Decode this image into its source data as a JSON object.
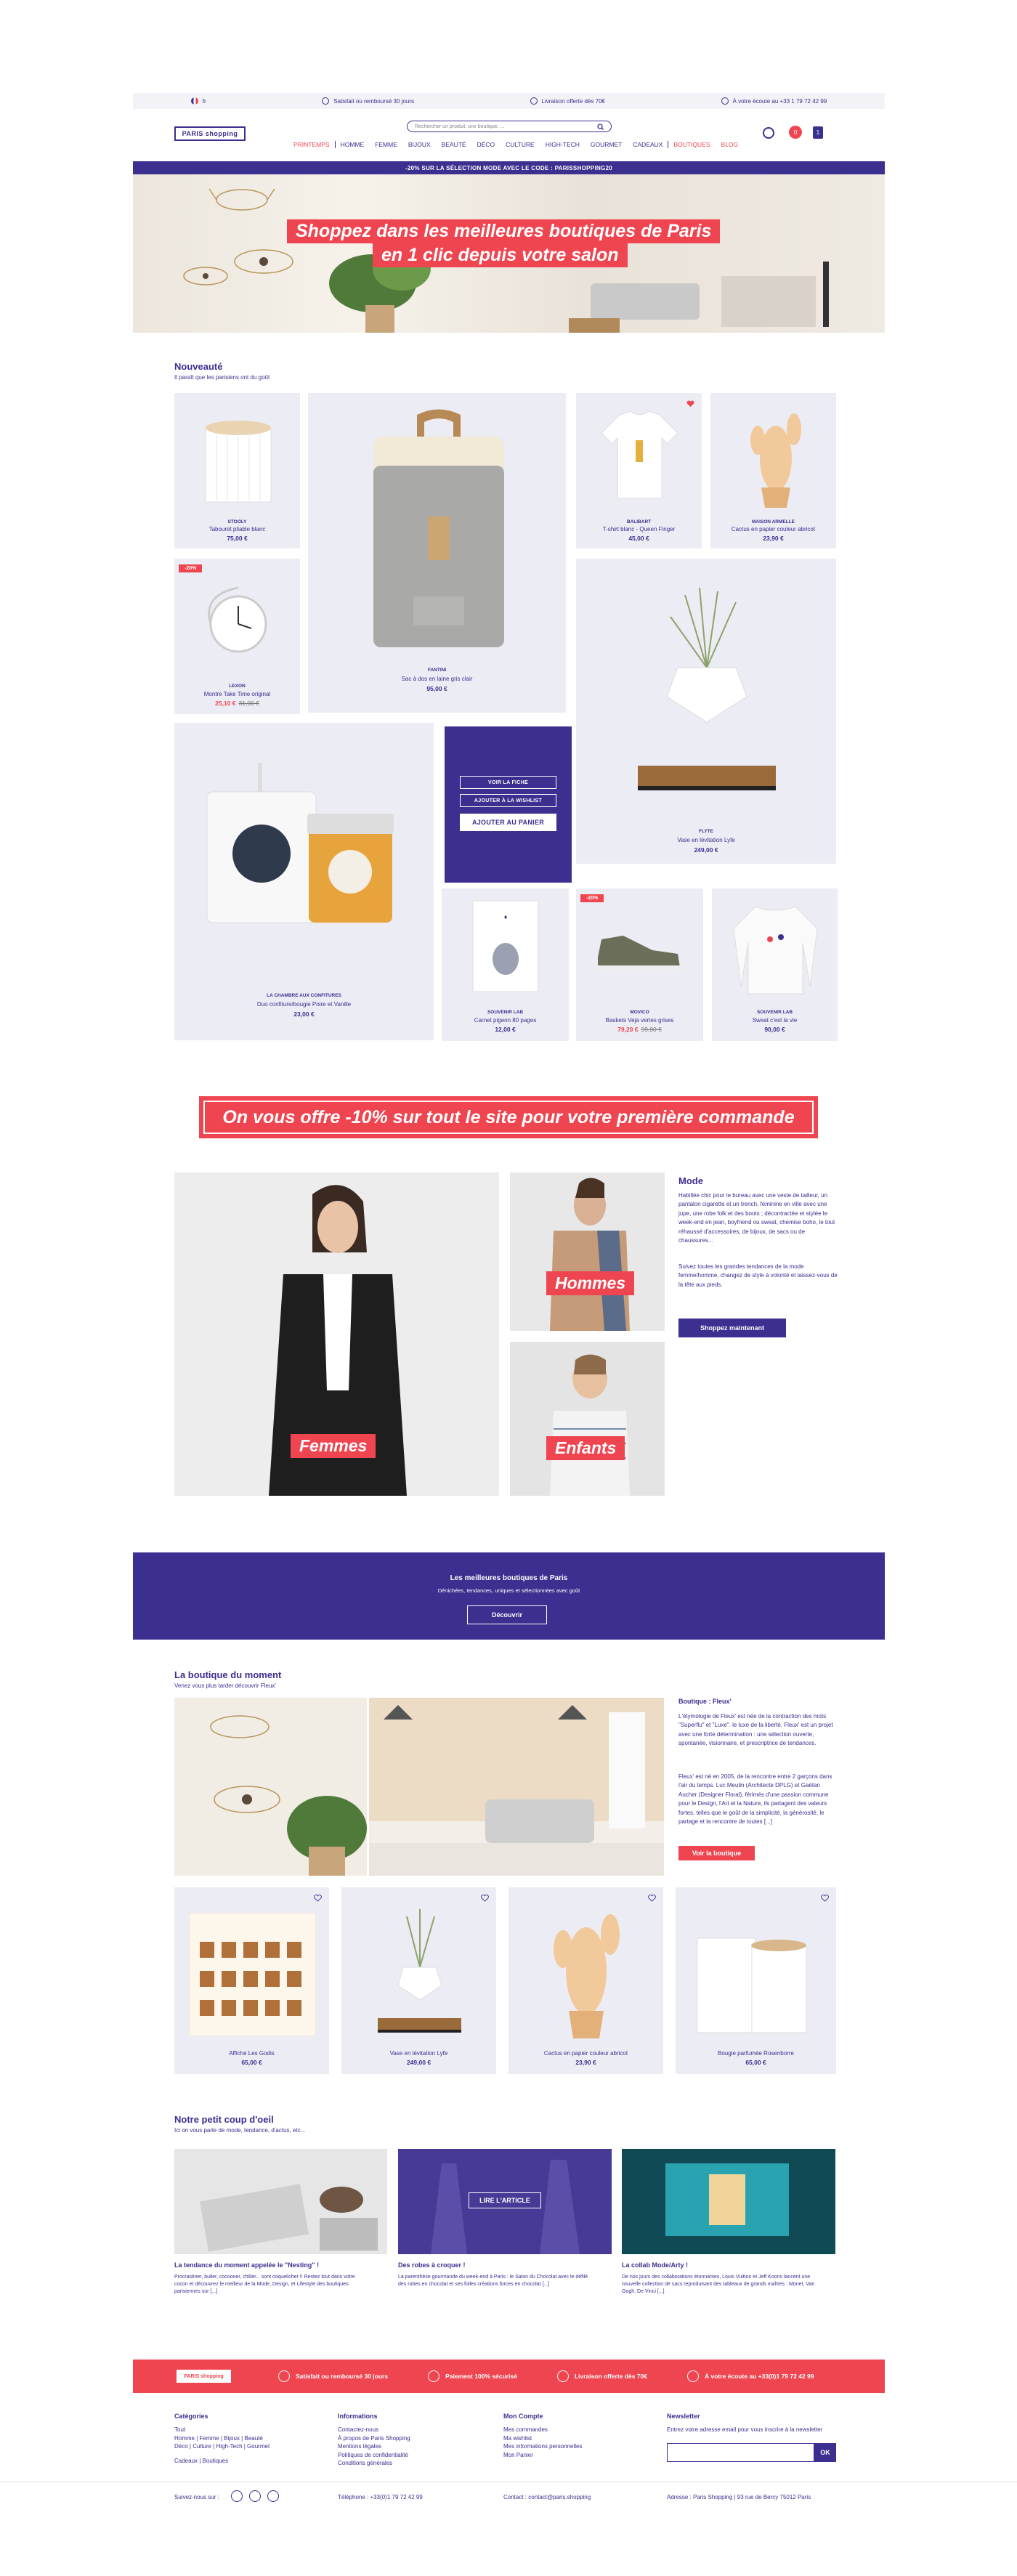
{
  "topbar": {
    "lang": "fr",
    "item1": "Satisfait ou remboursé 30 jours",
    "item2": "Livraison offerte dès 70€",
    "item3": "À votre écoute au +33 1 79 72 42 99"
  },
  "header": {
    "logo": "PARIS shopping",
    "search_placeholder": "Rechercher un produit, une boutique, ...",
    "cart_count": "1",
    "wishlist_count": "0",
    "nav": [
      "PRINTEMPS",
      "HOMME",
      "FEMME",
      "BIJOUX",
      "BEAUTÉ",
      "DÉCO",
      "CULTURE",
      "HIGH-TECH",
      "GOURMET",
      "CADEAUX",
      "BOUTIQUES",
      "BLOG"
    ],
    "promo": "-20% SUR LA SÉLECTION MODE AVEC LE CODE : PARISSHOPPING20"
  },
  "hero": {
    "line1": "Shoppez dans les meilleures boutiques de Paris",
    "line2": "en 1 clic depuis votre salon"
  },
  "new_section": {
    "title": "Nouveauté",
    "subtitle": "Il paraît que les parisiens ont du goût",
    "products": [
      {
        "brand": "STOOLY",
        "name": "Tabouret pliable blanc",
        "price": "75,00 €"
      },
      {
        "brand": "FANTINI",
        "name": "Sac à dos en laine gris clair",
        "price": "95,00 €"
      },
      {
        "brand": "BALIBART",
        "name": "T-shirt blanc - Queen Finger",
        "price": "45,00 €"
      },
      {
        "brand": "MAISON ARMELLE",
        "name": "Cactus en papier couleur abricot",
        "price": "23,90 €"
      },
      {
        "brand": "LEXON",
        "name": "Montre Take Time original",
        "price": "25,10 €",
        "old": "31,00 €",
        "badge": "-20%"
      },
      {
        "brand": "FLYTE",
        "name": "Vase en lévitation Lyfe",
        "price": "249,00 €"
      },
      {
        "brand": "LA CHAMBRE AUX CONFITURES",
        "name": "Duo confiture/bougie Poire et Vanille",
        "price": "23,00 €"
      },
      {
        "brand": "SOUVENIR LAB",
        "name": "Carnet pigeon 80 pages",
        "price": "12,00 €"
      },
      {
        "brand": "MOVICO",
        "name": "Baskets Veja vertes grises",
        "price": "79,20 €",
        "old": "99,00 €",
        "badge": "-20%"
      },
      {
        "brand": "SOUVENIR LAB",
        "name": "Sweat c'est la vie",
        "price": "90,00 €"
      }
    ],
    "quickview": "VOIR LA FICHE",
    "wishlist": "AJOUTER À LA WISHLIST",
    "add_to_cart": "AJOUTER AU PANIER"
  },
  "offer": "On vous offre -10% sur tout le site pour votre première commande",
  "mode": {
    "femmes": "Femmes",
    "hommes": "Hommes",
    "enfants": "Enfants",
    "title": "Mode",
    "para1": "Habillée chic pour le bureau avec une veste de tailleur, un pantalon cigarette et un trench, féminine en ville avec une jupe, une robe folk et des boots ; décontractée et stylée le week-end en jean, boyfriend ou sweat, chemise boho, le tout réhaussé d'accessoires, de bijoux, de sacs ou de chaussures...",
    "para2": "Suivez toutes les grandes tendances de la mode femme/homme, changez de style à volonté et laissez-vous de la tête aux pieds.",
    "cta": "Shoppez maintenant"
  },
  "best": {
    "title": "Les meilleures boutiques de Paris",
    "subtitle": "Dénichées, tendances, uniques et sélectionnées avec goût",
    "cta": "Découvrir"
  },
  "boutique": {
    "title": "La boutique du moment",
    "subtitle": "Venez vous plus tarder découvrir Fleux'",
    "name": "Boutique : Fleux'",
    "para1": "L'étymologie de Fleux' est née de la contraction des mots \"Superflu\" et \"Luxe\". le luxe de la liberté. Fleux' est un projet avec une forte détermination : une sélection ouverte, spontanée, visionnaire, et prescriptrice de tendances.",
    "para2": "Fleux' est né en 2005, de la rencontre entre 2 garçons dans l'air du temps. Luc Meulin (Architecte DPLG) et Gaëtan Aucher (Designer Floral), férimés d'une passion commune pour le Design, l'Art et la Nature, ils partagent des valeurs fortes, telles que le goût de la simplicité, la générosité, le partage et la rencontre de toutes [...]",
    "cta": "Voir la boutique",
    "products": [
      {
        "name": "Affiche Les Godis",
        "price": "65,00 €"
      },
      {
        "name": "Vase en lévitation Lyfe",
        "price": "249,00 €"
      },
      {
        "name": "Cactus en papier couleur abricot",
        "price": "23,90 €"
      },
      {
        "name": "Bougie parfumée Rosenborre",
        "price": "65,00 €"
      }
    ]
  },
  "blog": {
    "title": "Notre petit coup d'oeil",
    "subtitle": "Ici on vous parle de mode, tendance, d'actus, etc...",
    "read": "LIRE L'ARTICLE",
    "posts": [
      {
        "title": "La tendance du moment appelée le \"Nesting\" !",
        "text": "Procrastiner, buller, cocooner, chiller... sont coquelicher !! Restez tout dans votre cocon et découvrez le meilleur de la Mode, Design, et Lifestyle des boutiques parisiennes sur [...]"
      },
      {
        "title": "Des robes à croquer !",
        "text": "La parenthèse gourmande du week-end à Paris : le Salon du Chocolat avec le défilé des robes en chocolat et ses folles créations forces en chocolat [...]"
      },
      {
        "title": "La collab Mode/Arty !",
        "text": "De nos jours des collaborations étonnantes, Louis Vuitton et Jeff Koons lancent une nouvelle collection de sacs reproduisant des tableaux de grands maîtres : Monet, Van Gogh, De Vinci [...]"
      }
    ]
  },
  "footer": {
    "logo": "PARIS shopping",
    "bar": [
      "Satisfait ou remboursé 30 jours",
      "Paiement 100% sécurisé",
      "Livraison offerte dès 70€",
      "À votre écoute au +33(0)1 79 72 42 99"
    ],
    "col1_title": "Catégories",
    "col1": [
      "Tout",
      "Homme | Femme | Bijoux | Beauté",
      "Déco | Culture | High-Tech | Gourmet",
      "",
      "Cadeaux | Boutiques"
    ],
    "col2_title": "Informations",
    "col2": [
      "Contactez-nous",
      "À propos de Paris Shopping",
      "Mentions légales",
      "Politiques de confidentialité",
      "Conditions générales"
    ],
    "col3_title": "Mon Compte",
    "col3": [
      "Mes commandes",
      "Ma wishlist",
      "Mes informations personnelles",
      "Mon Panier"
    ],
    "col4_title": "Newsletter",
    "col4_text": "Entrez votre adresse email pour vous inscrire à la newsletter",
    "ok": "OK",
    "follow": "Suivez-nous sur :",
    "phone": "Téléphone : +33(0)1 79 72 42 99",
    "contact": "Contact : contact@paris.shopping",
    "address": "Adresse : Paris Shopping  |  93 rue de Bercy 75012 Paris"
  },
  "colors": {
    "navy": "#3b2f8f",
    "red": "#ef4550",
    "card": "#ececf4"
  }
}
